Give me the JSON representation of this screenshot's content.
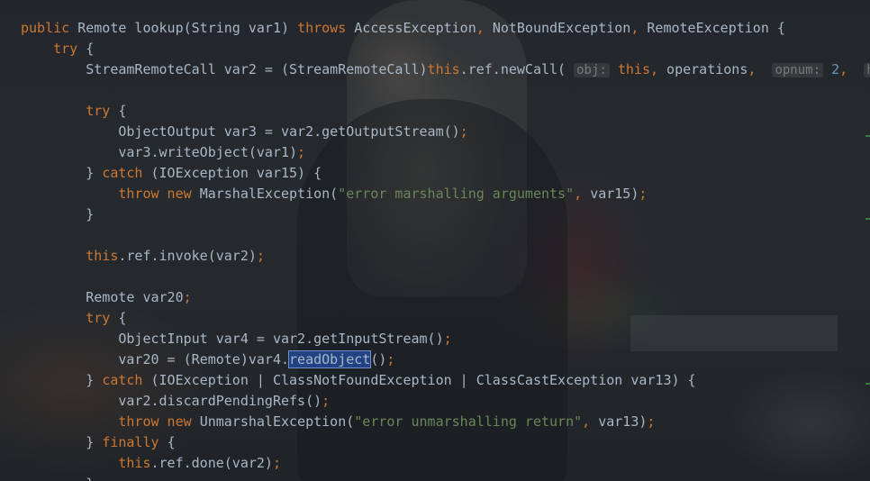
{
  "editor": {
    "lines": [
      [
        {
          "t": "public ",
          "c": "kw"
        },
        {
          "t": "Remote lookup(String var1) "
        },
        {
          "t": "throws ",
          "c": "kw"
        },
        {
          "t": "AccessException"
        },
        {
          "t": ", ",
          "c": "kw"
        },
        {
          "t": "NotBoundException"
        },
        {
          "t": ", ",
          "c": "kw"
        },
        {
          "t": "RemoteException {"
        }
      ],
      [
        {
          "t": "    "
        },
        {
          "t": "try ",
          "c": "kw"
        },
        {
          "t": "{"
        }
      ],
      [
        {
          "t": "        StreamRemoteCall var2 = (StreamRemoteCall)"
        },
        {
          "t": "this",
          "c": "kw"
        },
        {
          "t": ".ref.newCall( "
        },
        {
          "t": "obj:",
          "c": "hint"
        },
        {
          "t": " "
        },
        {
          "t": "this",
          "c": "kw"
        },
        {
          "t": ", ",
          "c": "kw"
        },
        {
          "t": "operations"
        },
        {
          "t": ", ",
          "c": "kw"
        },
        {
          "t": " "
        },
        {
          "t": "opnum:",
          "c": "hint"
        },
        {
          "t": " "
        },
        {
          "t": "2",
          "c": "num"
        },
        {
          "t": ", ",
          "c": "kw"
        },
        {
          "t": " "
        },
        {
          "t": "hash",
          "c": "hint"
        }
      ],
      [
        {
          "t": ""
        }
      ],
      [
        {
          "t": "        "
        },
        {
          "t": "try ",
          "c": "kw"
        },
        {
          "t": "{"
        }
      ],
      [
        {
          "t": "            ObjectOutput var3 = var2.getOutputStream()"
        },
        {
          "t": ";",
          "c": "kw"
        }
      ],
      [
        {
          "t": "            var3.writeObject(var1)"
        },
        {
          "t": ";",
          "c": "kw"
        }
      ],
      [
        {
          "t": "        } "
        },
        {
          "t": "catch ",
          "c": "kw"
        },
        {
          "t": "(IOException var15) {"
        }
      ],
      [
        {
          "t": "            "
        },
        {
          "t": "throw new ",
          "c": "kw"
        },
        {
          "t": "MarshalException("
        },
        {
          "t": "\"error marshalling arguments\"",
          "c": "str"
        },
        {
          "t": ", ",
          "c": "kw"
        },
        {
          "t": "var15)"
        },
        {
          "t": ";",
          "c": "kw"
        }
      ],
      [
        {
          "t": "        }"
        }
      ],
      [
        {
          "t": ""
        }
      ],
      [
        {
          "t": "        "
        },
        {
          "t": "this",
          "c": "kw"
        },
        {
          "t": ".ref.invoke(var2)"
        },
        {
          "t": ";",
          "c": "kw"
        }
      ],
      [
        {
          "t": ""
        }
      ],
      [
        {
          "t": "        Remote var20"
        },
        {
          "t": ";",
          "c": "kw"
        }
      ],
      [
        {
          "t": "        "
        },
        {
          "t": "try ",
          "c": "kw"
        },
        {
          "t": "{"
        }
      ],
      [
        {
          "t": "            ObjectInput var4 = var2.getInputStream()"
        },
        {
          "t": ";",
          "c": "kw"
        }
      ],
      [
        {
          "t": "            var20 = (Remote)var4."
        },
        {
          "t": "readObject",
          "c": "sel"
        },
        {
          "t": "()"
        },
        {
          "t": ";",
          "c": "kw"
        }
      ],
      [
        {
          "t": "        } "
        },
        {
          "t": "catch ",
          "c": "kw"
        },
        {
          "t": "(IOException | ClassNotFoundException | ClassCastException var13) {"
        }
      ],
      [
        {
          "t": "            var2.discardPendingRefs()"
        },
        {
          "t": ";",
          "c": "kw"
        }
      ],
      [
        {
          "t": "            "
        },
        {
          "t": "throw new ",
          "c": "kw"
        },
        {
          "t": "UnmarshalException("
        },
        {
          "t": "\"error unmarshalling return\"",
          "c": "str"
        },
        {
          "t": ", ",
          "c": "kw"
        },
        {
          "t": "var13)"
        },
        {
          "t": ";",
          "c": "kw"
        }
      ],
      [
        {
          "t": "        } "
        },
        {
          "t": "finally ",
          "c": "kw"
        },
        {
          "t": "{"
        }
      ],
      [
        {
          "t": "            "
        },
        {
          "t": "this",
          "c": "kw"
        },
        {
          "t": ".ref.done(var2)"
        },
        {
          "t": ";",
          "c": "kw"
        }
      ],
      [
        {
          "t": "        }"
        }
      ]
    ]
  },
  "colors": {
    "keyword": "#cc7832",
    "identifier": "#a9b7c6",
    "string": "#6a8759",
    "number": "#6897bb",
    "param_hint": "#787878",
    "selection": "#214283"
  }
}
